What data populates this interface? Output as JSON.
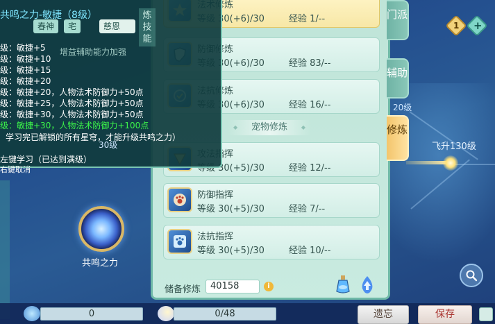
{
  "map": {
    "feisheng_label": "飞升130级",
    "level_20_label": "20级",
    "level_30_label": "30级",
    "badge_gold": "1",
    "badge_teal": "+",
    "resonance_label": "共鸣之力"
  },
  "tooltip": {
    "title": "共鸣之力-敏捷（8级）",
    "chips": [
      "春神",
      "宅",
      "慈恩"
    ],
    "vertical_tab": "炼技能",
    "description": "增益辅助能力加强",
    "levels": [
      "级：敏捷+5",
      "级：敏捷+10",
      "级：敏捷+15",
      "级：敏捷+20",
      "级：敏捷+20，人物法术防御力+50点",
      "级：敏捷+25，人物法术防御力+50点",
      "级：敏捷+30，人物法术防御力+50点",
      "级：敏捷+30，人物法术防御力+100点"
    ],
    "active_level_index": 7,
    "note": "学习完已解锁的所有星穹，才能升级共鸣之力）",
    "action_learn": "左键学习（已达到满级）",
    "action_cancel": "右键取消"
  },
  "panel": {
    "rows": [
      {
        "name": "法术修炼",
        "stat": "等级 30(+6)/30",
        "exp": "经验 1/--",
        "highlight": true
      },
      {
        "name": "防御修炼",
        "stat": "等级 30(+6)/30",
        "exp": "经验 83/--",
        "highlight": false
      },
      {
        "name": "法抗修炼",
        "stat": "等级 30(+6)/30",
        "exp": "经验 16/--",
        "highlight": false
      },
      {
        "name": "攻法指挥",
        "stat": "等级 30(+5)/30",
        "exp": "经验 12/--",
        "highlight": false
      },
      {
        "name": "防御指挥",
        "stat": "等级 30(+5)/30",
        "exp": "经验 7/--",
        "highlight": false
      },
      {
        "name": "法抗指挥",
        "stat": "等级 30(+5)/30",
        "exp": "经验 10/--",
        "highlight": false
      }
    ],
    "pet_section_title": "宠物修炼",
    "reserve_label": "储备修炼",
    "reserve_value": "40158",
    "info_glyph": "i"
  },
  "tabs": [
    {
      "label": "门派",
      "active": false
    },
    {
      "label": "辅助",
      "active": false
    },
    {
      "label": "修炼",
      "active": true
    }
  ],
  "bottom": {
    "field_1_value": "0",
    "field_2_value": "0/48",
    "forget_button": "遗忘",
    "save_button": "保存"
  },
  "icons": {
    "row_icons": [
      "spell-cultivation-icon",
      "shield-icon",
      "magic-resist-icon",
      "attack-command-icon",
      "paw-defense-icon",
      "paw-resist-icon"
    ],
    "search": "search-icon",
    "potion": "potion-icon",
    "upgrade": "upgrade-flame-icon"
  }
}
